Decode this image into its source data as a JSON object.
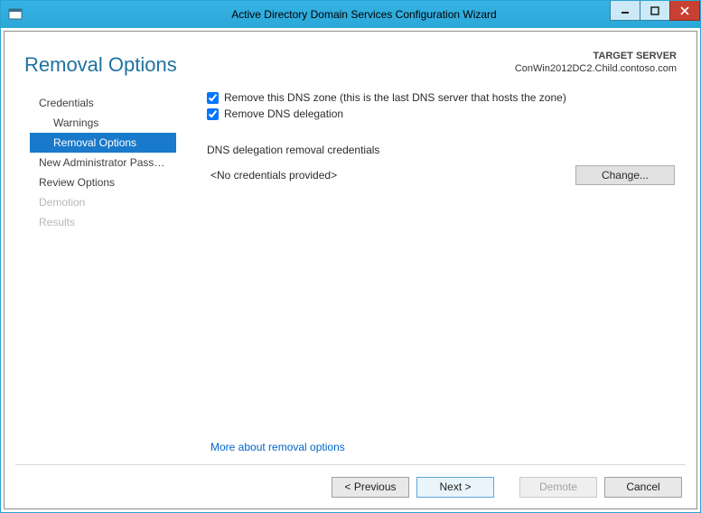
{
  "window": {
    "title": "Active Directory Domain Services Configuration Wizard"
  },
  "header": {
    "page_title": "Removal Options",
    "target_label": "TARGET SERVER",
    "target_value": "ConWin2012DC2.Child.contoso.com"
  },
  "nav": {
    "items": [
      {
        "label": "Credentials",
        "sub": false,
        "selected": false,
        "disabled": false
      },
      {
        "label": "Warnings",
        "sub": true,
        "selected": false,
        "disabled": false
      },
      {
        "label": "Removal Options",
        "sub": true,
        "selected": true,
        "disabled": false
      },
      {
        "label": "New Administrator Passw...",
        "sub": false,
        "selected": false,
        "disabled": false
      },
      {
        "label": "Review Options",
        "sub": false,
        "selected": false,
        "disabled": false
      },
      {
        "label": "Demotion",
        "sub": false,
        "selected": false,
        "disabled": true
      },
      {
        "label": "Results",
        "sub": false,
        "selected": false,
        "disabled": true
      }
    ]
  },
  "pane": {
    "chk1_label": "Remove this DNS zone (this is the last DNS server that hosts the zone)",
    "chk1_checked": true,
    "chk2_label": "Remove DNS delegation",
    "chk2_checked": true,
    "section_label": "DNS delegation removal credentials",
    "cred_text": "<No credentials provided>",
    "change_label": "Change...",
    "more_link": "More about removal options"
  },
  "footer": {
    "previous": "< Previous",
    "next": "Next >",
    "demote": "Demote",
    "cancel": "Cancel"
  }
}
